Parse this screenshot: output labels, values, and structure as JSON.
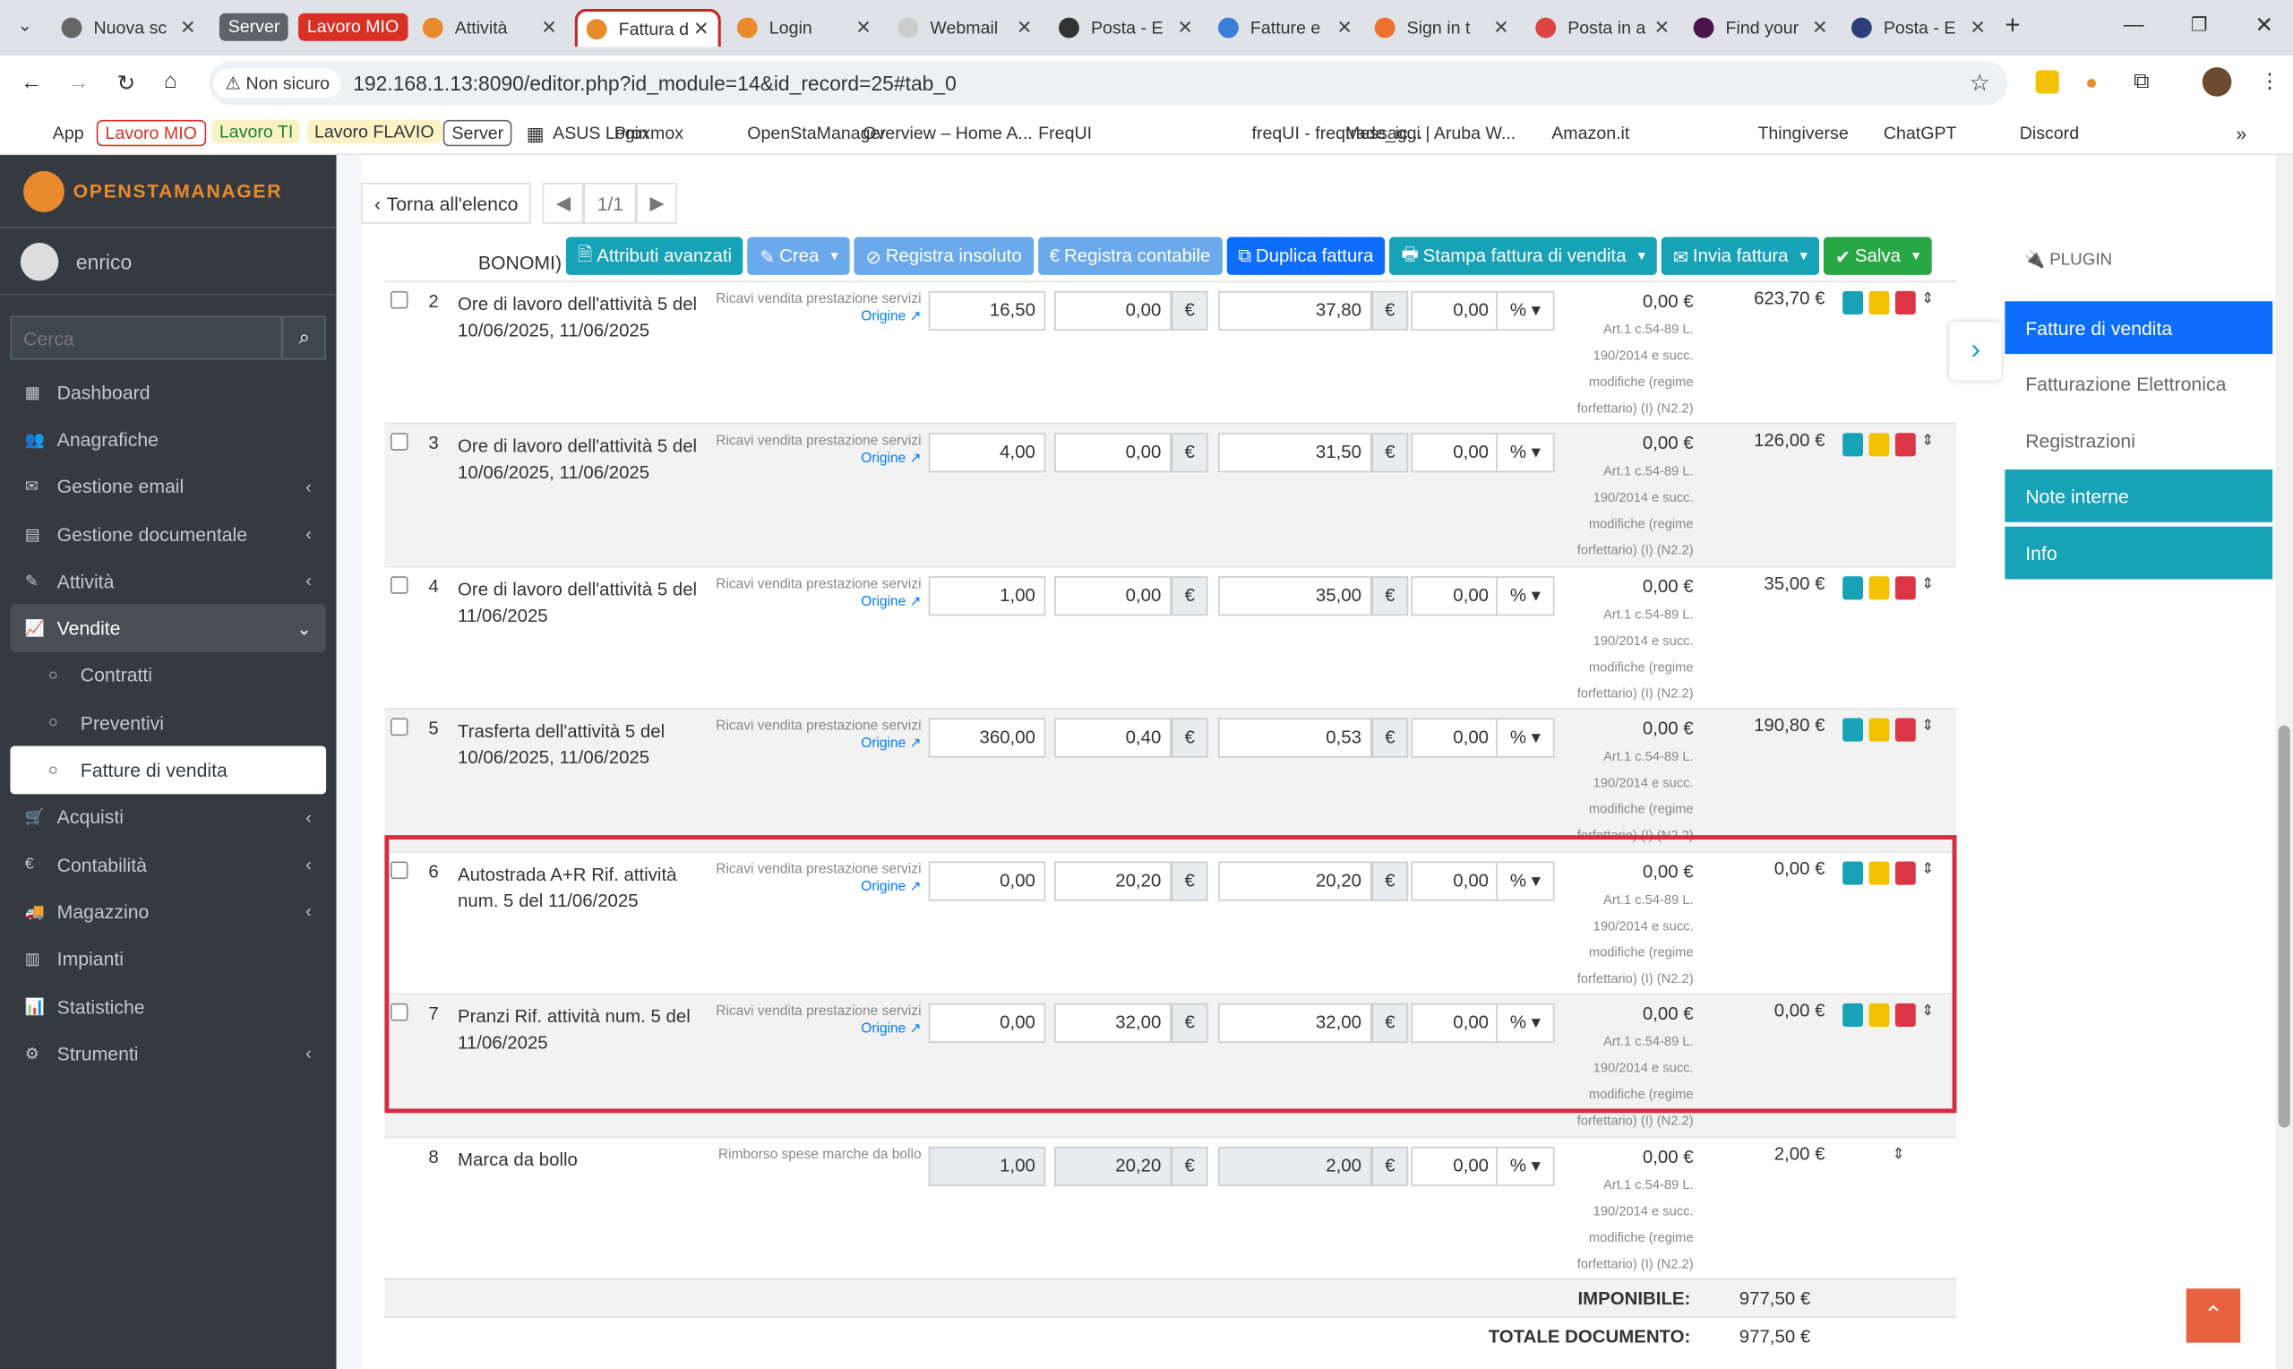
{
  "browser": {
    "tabs": [
      {
        "label": "Nuova sc",
        "color": "#666"
      },
      {
        "label": "Attività",
        "color": "#e98a2c"
      },
      {
        "label": "Fattura d",
        "color": "#e98a2c"
      },
      {
        "label": "Login",
        "color": "#e98a2c"
      },
      {
        "label": "Webmail",
        "color": "#ccc"
      },
      {
        "label": "Posta - E",
        "color": "#333"
      },
      {
        "label": "Fatture e",
        "color": "#3b7dd8"
      },
      {
        "label": "Sign in t",
        "color": "#f07030"
      },
      {
        "label": "Posta in a",
        "color": "#d44"
      },
      {
        "label": "Find your",
        "color": "#4a154b"
      },
      {
        "label": "Posta - E",
        "color": "#2d3e7a"
      }
    ],
    "groups": [
      {
        "label": "Server",
        "color": "#5f6368"
      },
      {
        "label": "Lavoro MIO",
        "color": "#d93025"
      }
    ],
    "security": "Non sicuro",
    "url": "192.168.1.13:8090/editor.php?id_module=14&id_record=25#tab_0",
    "bookmarks": [
      "App",
      "Lavoro MIO",
      "Lavoro TI",
      "Lavoro FLAVIO",
      "Server",
      "ASUS Login",
      "Proxmox",
      "OpenStaManager",
      "Overview – Home A...",
      "FreqUI",
      "freqUI - freqtrade_ic...",
      "Messaggi | Aruba W...",
      "Amazon.it",
      "Thingiverse",
      "ChatGPT",
      "Discord"
    ]
  },
  "sidebar": {
    "brand": "OPENSTAMANAGER",
    "user": "enrico",
    "search_placeholder": "Cerca",
    "items": [
      {
        "label": "Dashboard",
        "icon": "▦",
        "chev": ""
      },
      {
        "label": "Anagrafiche",
        "icon": "👥",
        "chev": ""
      },
      {
        "label": "Gestione email",
        "icon": "✉",
        "chev": "‹"
      },
      {
        "label": "Gestione documentale",
        "icon": "▤",
        "chev": "‹"
      },
      {
        "label": "Attività",
        "icon": "✎",
        "chev": "‹"
      },
      {
        "label": "Vendite",
        "icon": "📈",
        "chev": "⌄"
      },
      {
        "label": "Contratti",
        "icon": "○",
        "chev": ""
      },
      {
        "label": "Preventivi",
        "icon": "○",
        "chev": ""
      },
      {
        "label": "Fatture di vendita",
        "icon": "○",
        "chev": ""
      },
      {
        "label": "Acquisti",
        "icon": "🛒",
        "chev": "‹"
      },
      {
        "label": "Contabilità",
        "icon": "€",
        "chev": "‹"
      },
      {
        "label": "Magazzino",
        "icon": "🚚",
        "chev": "‹"
      },
      {
        "label": "Impianti",
        "icon": "▥",
        "chev": ""
      },
      {
        "label": "Statistiche",
        "icon": "📊",
        "chev": ""
      },
      {
        "label": "Strumenti",
        "icon": "⚙",
        "chev": "‹"
      }
    ]
  },
  "toolbar": {
    "back": "Torna all'elenco",
    "page": "1/1",
    "buttons": [
      "Attributi avanzati",
      "Crea",
      "Registra insoluto",
      "Registra contabile",
      "Duplica fattura",
      "Stampa fattura di vendita",
      "Invia fattura",
      "Salva"
    ],
    "partial_row_text": "BONOMI)"
  },
  "rows": [
    {
      "n": "2",
      "desc": "Ore di lavoro dell'attività 5 del 10/06/2025, 11/06/2025",
      "acc": "Ricavi vendita prestazione servizi",
      "origin": "Origine",
      "qty": "16,50",
      "disc": "0,00",
      "price": "37,80",
      "pct": "0,00",
      "iva": "0,00 €",
      "tot": "623,70 €"
    },
    {
      "n": "3",
      "desc": "Ore di lavoro dell'attività 5 del 10/06/2025, 11/06/2025",
      "acc": "Ricavi vendita prestazione servizi",
      "origin": "Origine",
      "qty": "4,00",
      "disc": "0,00",
      "price": "31,50",
      "pct": "0,00",
      "iva": "0,00 €",
      "tot": "126,00 €"
    },
    {
      "n": "4",
      "desc": "Ore di lavoro dell'attività 5 del 11/06/2025",
      "acc": "Ricavi vendita prestazione servizi",
      "origin": "Origine",
      "qty": "1,00",
      "disc": "0,00",
      "price": "35,00",
      "pct": "0,00",
      "iva": "0,00 €",
      "tot": "35,00 €"
    },
    {
      "n": "5",
      "desc": "Trasferta dell'attività 5 del 10/06/2025, 11/06/2025",
      "acc": "Ricavi vendita prestazione servizi",
      "origin": "Origine",
      "qty": "360,00",
      "disc": "0,40",
      "price": "0,53",
      "pct": "0,00",
      "iva": "0,00 €",
      "tot": "190,80 €"
    },
    {
      "n": "6",
      "desc": "Autostrada A+R Rif. attività num. 5 del 11/06/2025",
      "acc": "Ricavi vendita prestazione servizi",
      "origin": "Origine",
      "qty": "0,00",
      "disc": "20,20",
      "price": "20,20",
      "pct": "0,00",
      "iva": "0,00 €",
      "tot": "0,00 €"
    },
    {
      "n": "7",
      "desc": "Pranzi Rif. attività num. 5 del 11/06/2025",
      "acc": "Ricavi vendita prestazione servizi",
      "origin": "Origine",
      "qty": "0,00",
      "disc": "32,00",
      "price": "32,00",
      "pct": "0,00",
      "iva": "0,00 €",
      "tot": "0,00 €"
    },
    {
      "n": "8",
      "desc": "Marca da bollo",
      "acc": "Rimborso spese marche da bollo",
      "origin": "",
      "qty": "1,00",
      "disc": "20,20",
      "price": "2,00",
      "pct": "0,00",
      "iva": "0,00 €",
      "tot": "2,00 €"
    }
  ],
  "iva_note": "Art.1 c.54-89 L. 190/2014 e succ. modifiche (regime forfettario) (I) (N2.2)",
  "unit_sym": "€",
  "pct_sym": "%",
  "totals": {
    "imponibile_label": "IMPONIBILE:",
    "imponibile": "977,50 €",
    "totale_label": "TOTALE DOCUMENTO:",
    "totale": "977,50 €"
  },
  "right_panel": {
    "title": "PLUGIN",
    "items": [
      "Fatture di vendita",
      "Fatturazione Elettronica",
      "Registrazioni",
      "Note interne",
      "Info"
    ]
  }
}
